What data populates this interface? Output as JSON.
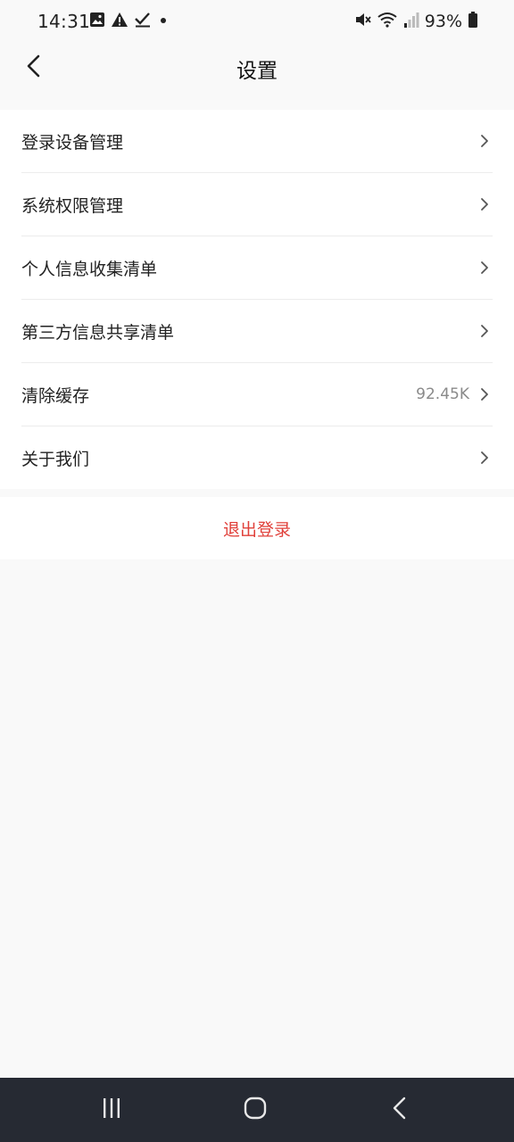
{
  "status_bar": {
    "time": "14:31",
    "battery": "93%",
    "left_icons": [
      "gallery-icon",
      "warning-icon",
      "checkmark-icon",
      "dot-icon"
    ],
    "right_icons": [
      "mute-icon",
      "wifi-icon",
      "signal-icon",
      "battery-icon"
    ]
  },
  "app_bar": {
    "title": "设置",
    "back_icon": "chevron-left-icon"
  },
  "settings": {
    "items": [
      {
        "label": "登录设备管理",
        "value": ""
      },
      {
        "label": "系统权限管理",
        "value": ""
      },
      {
        "label": "个人信息收集清单",
        "value": ""
      },
      {
        "label": "第三方信息共享清单",
        "value": ""
      },
      {
        "label": "清除缓存",
        "value": "92.45K"
      },
      {
        "label": "关于我们",
        "value": ""
      }
    ]
  },
  "logout": {
    "label": "退出登录",
    "color": "#e0403a"
  },
  "nav_bar": {
    "buttons": [
      "recent-apps-icon",
      "home-icon",
      "back-icon"
    ],
    "background": "#262a33"
  }
}
